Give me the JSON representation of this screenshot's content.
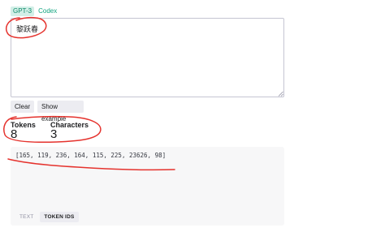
{
  "model_tabs": [
    {
      "label": "GPT-3",
      "active": true
    },
    {
      "label": "Codex",
      "active": false
    }
  ],
  "input": {
    "value": "黎跃春"
  },
  "buttons": {
    "clear": "Clear",
    "show_example": "Show example"
  },
  "stats": {
    "tokens_label": "Tokens",
    "tokens_value": "8",
    "characters_label": "Characters",
    "characters_value": "3"
  },
  "output": {
    "token_ids": "[165, 119, 236, 164, 115, 225, 23626, 98]"
  },
  "view_tabs": [
    {
      "label": "TEXT",
      "active": false
    },
    {
      "label": "TOKEN IDS",
      "active": true
    }
  ],
  "colors": {
    "accent": "#10a37f",
    "annotation": "#e5322d"
  }
}
